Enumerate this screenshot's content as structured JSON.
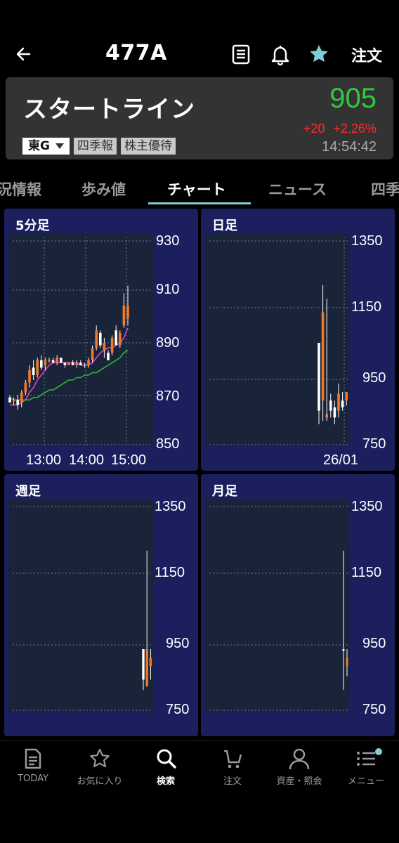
{
  "header": {
    "symbol": "477A",
    "order_label": "注文",
    "icons": [
      "back-arrow-icon",
      "document-icon",
      "bell-icon",
      "star-icon"
    ]
  },
  "stock": {
    "name": "スタートライン",
    "price": "905",
    "change_abs": "+20",
    "change_pct": "+2.26%",
    "time": "14:54:42",
    "market_label": "東G",
    "badges": [
      "四季報",
      "株主優待"
    ],
    "colors": {
      "price": "#32c93e",
      "change": "#ff2a2a",
      "accent": "#7ecfd4"
    }
  },
  "tabs": [
    "況情報",
    "歩み値",
    "チャート",
    "ニュース",
    "四季"
  ],
  "active_tab": "チャート",
  "charts": {
    "five_min": {
      "title": "5分足",
      "y_ticks": [
        "930",
        "910",
        "890",
        "870",
        "850"
      ],
      "x_ticks": [
        "13:00",
        "14:00",
        "15:00"
      ]
    },
    "daily": {
      "title": "日足",
      "y_ticks": [
        "1350",
        "1150",
        "950",
        "750"
      ],
      "x_ticks": [
        "26/01"
      ]
    },
    "weekly": {
      "title": "週足",
      "y_ticks": [
        "1350",
        "1150",
        "950",
        "750"
      ]
    },
    "monthly": {
      "title": "月足",
      "y_ticks": [
        "1350",
        "1150",
        "950",
        "750"
      ]
    }
  },
  "chart_data": [
    {
      "type": "candlestick",
      "title": "5分足",
      "ylim": [
        850,
        932
      ],
      "x_ticks": [
        "13:00",
        "14:00",
        "15:00"
      ],
      "candles": [
        {
          "o": 869,
          "h": 870,
          "l": 867,
          "c": 867
        },
        {
          "o": 868,
          "h": 869,
          "l": 866,
          "c": 868
        },
        {
          "o": 868,
          "h": 870,
          "l": 864,
          "c": 866
        },
        {
          "o": 867,
          "h": 872,
          "l": 865,
          "c": 871
        },
        {
          "o": 871,
          "h": 876,
          "l": 870,
          "c": 875
        },
        {
          "o": 875,
          "h": 882,
          "l": 873,
          "c": 880
        },
        {
          "o": 881,
          "h": 884,
          "l": 876,
          "c": 878
        },
        {
          "o": 878,
          "h": 885,
          "l": 877,
          "c": 884
        },
        {
          "o": 884,
          "h": 886,
          "l": 880,
          "c": 881
        },
        {
          "o": 882,
          "h": 885,
          "l": 880,
          "c": 884
        },
        {
          "o": 884,
          "h": 885,
          "l": 883,
          "c": 884
        },
        {
          "o": 884,
          "h": 885,
          "l": 883,
          "c": 883
        },
        {
          "o": 883,
          "h": 886,
          "l": 882,
          "c": 885
        },
        {
          "o": 885,
          "h": 885,
          "l": 883,
          "c": 883
        },
        {
          "o": 883,
          "h": 883,
          "l": 881,
          "c": 882
        },
        {
          "o": 882,
          "h": 883,
          "l": 882,
          "c": 883
        },
        {
          "o": 883,
          "h": 884,
          "l": 882,
          "c": 882
        },
        {
          "o": 882,
          "h": 884,
          "l": 881,
          "c": 883
        },
        {
          "o": 883,
          "h": 884,
          "l": 882,
          "c": 882
        },
        {
          "o": 882,
          "h": 883,
          "l": 881,
          "c": 882
        },
        {
          "o": 882,
          "h": 885,
          "l": 881,
          "c": 884
        },
        {
          "o": 884,
          "h": 890,
          "l": 883,
          "c": 889
        },
        {
          "o": 889,
          "h": 898,
          "l": 888,
          "c": 896
        },
        {
          "o": 895,
          "h": 896,
          "l": 889,
          "c": 890
        },
        {
          "o": 888,
          "h": 893,
          "l": 885,
          "c": 891
        },
        {
          "o": 887,
          "h": 888,
          "l": 884,
          "c": 884
        },
        {
          "o": 887,
          "h": 894,
          "l": 886,
          "c": 893
        },
        {
          "o": 896,
          "h": 898,
          "l": 890,
          "c": 890
        },
        {
          "o": 890,
          "h": 896,
          "l": 889,
          "c": 895
        },
        {
          "o": 898,
          "h": 911,
          "l": 897,
          "c": 906
        },
        {
          "o": 901,
          "h": 914,
          "l": 898,
          "c": 906
        }
      ],
      "series": [
        {
          "name": "short MA",
          "color": "#e040c8",
          "values": [
            866,
            866,
            866,
            867,
            868,
            871,
            873,
            876,
            878,
            880,
            882,
            883,
            883,
            883,
            883,
            883,
            883,
            883,
            882,
            882,
            882,
            883,
            885,
            887,
            888,
            889,
            889,
            890,
            891,
            893,
            897
          ]
        },
        {
          "name": "long MA",
          "color": "#2fb52f",
          "values": [
            869,
            868,
            868,
            868,
            868,
            868,
            869,
            869,
            870,
            871,
            872,
            872,
            873,
            874,
            875,
            876,
            876,
            877,
            877,
            878,
            878,
            879,
            879,
            880,
            881,
            882,
            883,
            884,
            885,
            887,
            888
          ]
        }
      ]
    },
    {
      "type": "candlestick",
      "title": "日足",
      "ylim": [
        750,
        1350
      ],
      "x_ticks": [
        "26/01"
      ],
      "candles": [
        {
          "o": 1050,
          "h": 1050,
          "l": 810,
          "c": 850
        },
        {
          "o": 880,
          "h": 1220,
          "l": 820,
          "c": 1140
        },
        {
          "o": 830,
          "h": 1180,
          "l": 820,
          "c": 840
        },
        {
          "o": 880,
          "h": 900,
          "l": 830,
          "c": 850
        },
        {
          "o": 860,
          "h": 880,
          "l": 810,
          "c": 830
        },
        {
          "o": 850,
          "h": 930,
          "l": 830,
          "c": 900
        },
        {
          "o": 880,
          "h": 905,
          "l": 850,
          "c": 860
        },
        {
          "o": 880,
          "h": 905,
          "l": 865,
          "c": 905
        }
      ]
    },
    {
      "type": "candlestick",
      "title": "週足",
      "ylim": [
        750,
        1350
      ],
      "candles": [
        {
          "o": 930,
          "h": 930,
          "l": 810,
          "c": 840
        },
        {
          "o": 820,
          "h": 1220,
          "l": 820,
          "c": 930
        },
        {
          "o": 880,
          "h": 930,
          "l": 840,
          "c": 905
        }
      ]
    },
    {
      "type": "candlestick",
      "title": "月足",
      "ylim": [
        750,
        1350
      ],
      "candles": [
        {
          "o": 930,
          "h": 1220,
          "l": 810,
          "c": 925
        },
        {
          "o": 880,
          "h": 930,
          "l": 850,
          "c": 905
        }
      ]
    }
  ],
  "bottom_nav": [
    {
      "label": "TODAY",
      "icon": "today-icon"
    },
    {
      "label": "お気に入り",
      "icon": "star-outline-icon"
    },
    {
      "label": "検索",
      "icon": "search-icon"
    },
    {
      "label": "注文",
      "icon": "cart-icon"
    },
    {
      "label": "資産・照会",
      "icon": "person-icon"
    },
    {
      "label": "メニュー",
      "icon": "menu-icon"
    }
  ],
  "bottom_nav_active": "検索"
}
